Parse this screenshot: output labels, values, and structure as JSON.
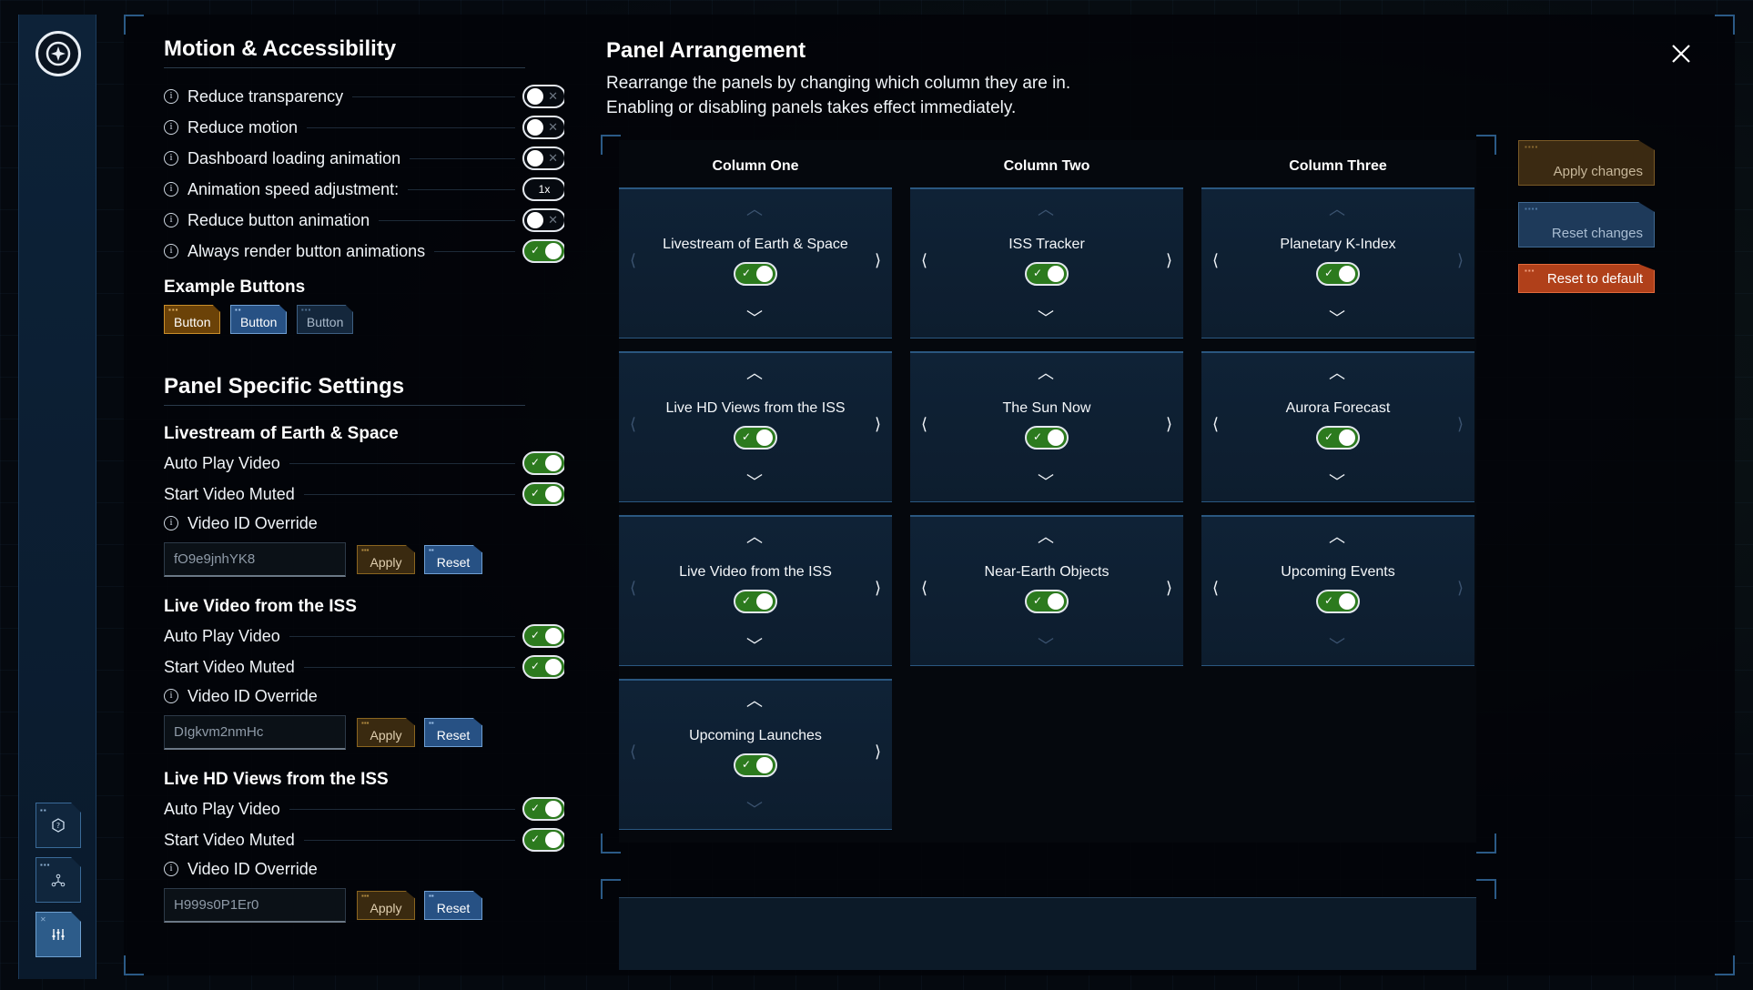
{
  "close_symbol": "✕",
  "motion": {
    "title": "Motion & Accessibility",
    "items": [
      {
        "label": "Reduce transparency",
        "state": "off"
      },
      {
        "label": "Reduce motion",
        "state": "off"
      },
      {
        "label": "Dashboard loading animation",
        "state": "off"
      },
      {
        "label": "Animation speed adjustment:",
        "value": "1x"
      },
      {
        "label": "Reduce button animation",
        "state": "off"
      },
      {
        "label": "Always render button animations",
        "state": "on"
      }
    ],
    "example_title": "Example Buttons",
    "example_buttons": [
      "Button",
      "Button",
      "Button"
    ]
  },
  "panel_settings": {
    "title": "Panel Specific Settings",
    "groups": [
      {
        "title": "Livestream of Earth & Space",
        "auto_play": "Auto Play Video",
        "muted": "Start Video Muted",
        "override": "Video ID Override",
        "video_id": "fO9e9jnhYK8",
        "apply": "Apply",
        "reset": "Reset"
      },
      {
        "title": "Live Video from the ISS",
        "auto_play": "Auto Play Video",
        "muted": "Start Video Muted",
        "override": "Video ID Override",
        "video_id": "DIgkvm2nmHc",
        "apply": "Apply",
        "reset": "Reset"
      },
      {
        "title": "Live HD Views from the ISS",
        "auto_play": "Auto Play Video",
        "muted": "Start Video Muted",
        "override": "Video ID Override",
        "video_id": "H999s0P1Er0",
        "apply": "Apply",
        "reset": "Reset"
      }
    ]
  },
  "arrangement": {
    "title": "Panel Arrangement",
    "desc1": "Rearrange the panels by changing which column they are in.",
    "desc2": "Enabling or disabling panels takes effect immediately.",
    "columns": [
      {
        "name": "Column One",
        "panels": [
          "Livestream of Earth & Space",
          "Live HD Views from the ISS",
          "Live Video from the ISS",
          "Upcoming Launches"
        ]
      },
      {
        "name": "Column Two",
        "panels": [
          "ISS Tracker",
          "The Sun Now",
          "Near-Earth Objects"
        ]
      },
      {
        "name": "Column Three",
        "panels": [
          "Planetary K-Index",
          "Aurora Forecast",
          "Upcoming Events"
        ]
      }
    ]
  },
  "actions": {
    "apply": "Apply changes",
    "reset": "Reset changes",
    "default": "Reset to default"
  },
  "glyphs": {
    "check": "✓",
    "cross": "✕",
    "info": "i",
    "up": "︿",
    "down": "﹀",
    "left": "⟨",
    "right": "⟩"
  }
}
